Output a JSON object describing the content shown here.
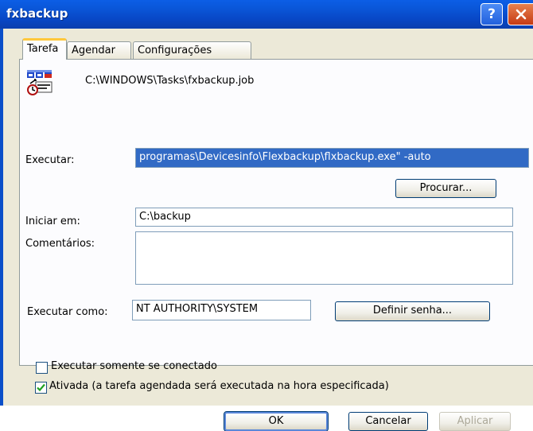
{
  "window": {
    "title": "fxbackup",
    "help_icon": "?",
    "close_icon": "x"
  },
  "tabs": [
    {
      "label": "Tarefa",
      "active": true
    },
    {
      "label": "Agendar",
      "active": false
    },
    {
      "label": "Configurações",
      "active": false
    }
  ],
  "task": {
    "icon": "scheduled-task-icon",
    "path": "C:\\WINDOWS\\Tasks\\fxbackup.job"
  },
  "form": {
    "executar_label": "Executar:",
    "executar_value": "programas\\Devicesinfo\\Flexbackup\\flxbackup.exe\" -auto",
    "procurar_label": "Procurar...",
    "iniciar_label": "Iniciar em:",
    "iniciar_value": "C:\\backup",
    "comentarios_label": "Comentários:",
    "comentarios_value": "",
    "executar_como_label": "Executar como:",
    "executar_como_value": "NT AUTHORITY\\SYSTEM",
    "definir_senha_label": "Definir senha..."
  },
  "options": {
    "somente_conectado_label": "Executar somente se  conectado",
    "somente_conectado_checked": false,
    "ativada_label": "Ativada (a tarefa agendada será executada na hora especificada)",
    "ativada_checked": true
  },
  "buttons": {
    "ok": "OK",
    "cancelar": "Cancelar",
    "aplicar": "Aplicar"
  },
  "colors": {
    "titlebar": "#0a56d8",
    "selection": "#316ac5",
    "tab_highlight": "#ffc83c"
  }
}
